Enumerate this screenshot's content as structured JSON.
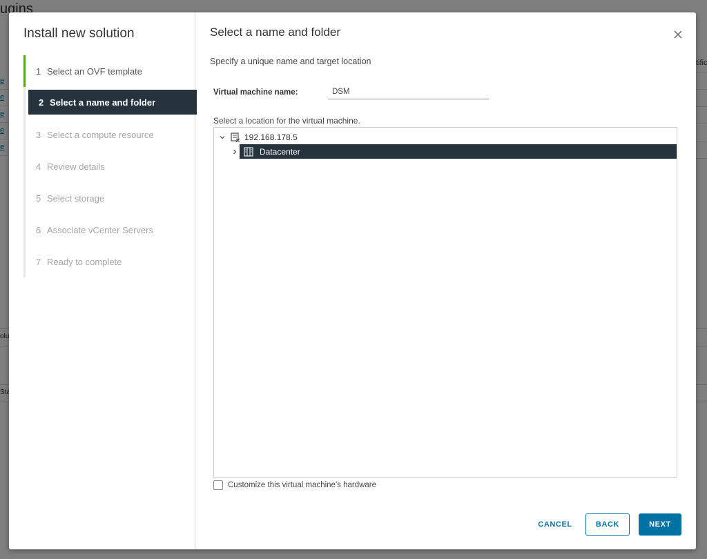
{
  "background": {
    "title_fragment": "ugins",
    "row_fragments": [
      "e A",
      "e S",
      "e V",
      "e V",
      "e V"
    ],
    "right_header_fragment": "tific",
    "strip1_fragment": "olu",
    "strip2_fragment": "Stat"
  },
  "wizard": {
    "title": "Install new solution",
    "steps": [
      {
        "num": "1",
        "label": "Select an OVF template",
        "state": "done"
      },
      {
        "num": "2",
        "label": "Select a name and folder",
        "state": "active"
      },
      {
        "num": "3",
        "label": "Select a compute resource",
        "state": "pending"
      },
      {
        "num": "4",
        "label": "Review details",
        "state": "pending"
      },
      {
        "num": "5",
        "label": "Select storage",
        "state": "pending"
      },
      {
        "num": "6",
        "label": "Associate vCenter Servers",
        "state": "pending"
      },
      {
        "num": "7",
        "label": "Ready to complete",
        "state": "pending"
      }
    ]
  },
  "content": {
    "title": "Select a name and folder",
    "subtitle": "Specify a unique name and target location",
    "vm_name_label": "Virtual machine name:",
    "vm_name_value": "DSM",
    "location_label": "Select a location for the virtual machine.",
    "tree": {
      "root": {
        "label": "192.168.178.5",
        "icon": "vcenter-server-icon",
        "expanded": true
      },
      "child": {
        "label": "Datacenter",
        "icon": "datacenter-icon",
        "expanded": false,
        "selected": true
      }
    },
    "customize_label": "Customize this virtual machine's hardware",
    "customize_checked": false
  },
  "buttons": {
    "cancel": "CANCEL",
    "back": "BACK",
    "next": "NEXT"
  },
  "colors": {
    "primary": "#0072a3",
    "selected_bg": "#25333d",
    "done_indicator": "#5aa220"
  }
}
